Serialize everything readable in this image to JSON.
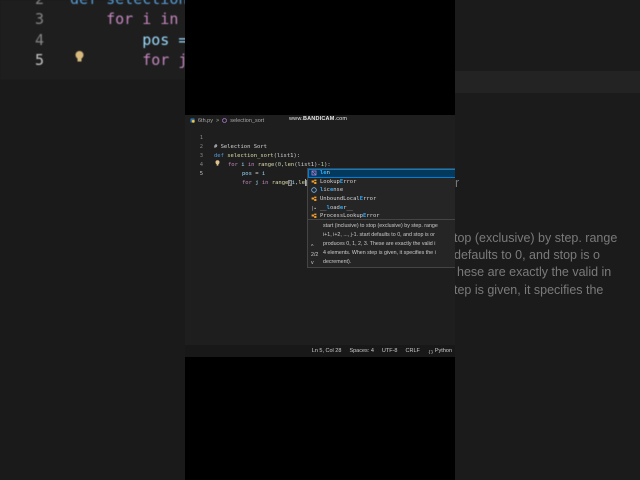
{
  "background": {
    "code_lines": [
      {
        "num": "2",
        "text": "def selection_"
      },
      {
        "num": "3",
        "text": "    for i in r"
      },
      {
        "num": "4",
        "text": "        pos ="
      },
      {
        "num": "5",
        "text": "        for j"
      }
    ],
    "right_doc_lines": [
      "r",
      "top (exclusive) by step. range",
      "defaults to 0, and stop is o",
      "hese are exactly the valid in",
      "tep is given, it specifies the"
    ]
  },
  "editor": {
    "breadcrumb": {
      "file": "6th.py",
      "symbol": "selection_sort",
      "sep": ">"
    },
    "watermark": {
      "prefix": "www.",
      "brand": "BANDICAM",
      "suffix": ".com"
    },
    "lines": [
      {
        "num": "1"
      },
      {
        "num": "2"
      },
      {
        "num": "3"
      },
      {
        "num": "4"
      },
      {
        "num": "5"
      }
    ],
    "code": {
      "l1": "# Selection Sort",
      "l2_kw": "def",
      "l2_fn": "selection_sort",
      "l2_rest": "(list1):",
      "l3_kw": "for",
      "l3_v": "i",
      "l3_in": "in",
      "l3_fn": "range",
      "l3_a": "(",
      "l3_n0": "0",
      "l3_b": ",",
      "l3_fn2": "len",
      "l3_c": "(list1)-",
      "l3_n1": "1",
      "l3_d": "):",
      "l4_v": "pos",
      "l4_eq": " = ",
      "l4_v2": "i",
      "l5_kw": "for",
      "l5_v": "j",
      "l5_in": "in",
      "l5_fn": "range",
      "l5_a": "(",
      "l5_v2": "i",
      "l5_b": ",",
      "l5_typed": "le",
      "l5_c": ")"
    },
    "suggestions": [
      {
        "hl": "le",
        "rest": "n",
        "icon": "method-icon"
      },
      {
        "pre": "Lookup",
        "hl": "E",
        "rest": "rror",
        "icon": "class-icon"
      },
      {
        "pre": "",
        "hl": "l",
        "mid": "ic",
        "hl2": "e",
        "rest": "nse",
        "icon": "variable-icon"
      },
      {
        "pre": "UnboundLocal",
        "hl": "E",
        "rest": "rror",
        "icon": "class-icon"
      },
      {
        "pre": "__",
        "hl": "l",
        "mid": "oad",
        "hl2": "e",
        "rest": "r__",
        "icon": "module-icon"
      },
      {
        "pre": "ProcessLookup",
        "hl": "E",
        "rest": "rror",
        "icon": "class-icon"
      }
    ],
    "details": {
      "lines": [
        "start (inclusive) to stop (exclusive) by step. range",
        "i+1, i+2, ..., j-1. start defaults to 0, and stop is or",
        "produces 0, 1, 2, 3. These are exactly the valid i",
        "4 elements. When step is given, it specifies the i",
        "decrement)."
      ],
      "sig_up": "^",
      "sig_count": "2/2",
      "sig_down": "v"
    },
    "status": {
      "position": "Ln 5, Col 28",
      "spaces": "Spaces: 4",
      "encoding": "UTF-8",
      "eol": "CRLF",
      "language": "Python"
    }
  }
}
